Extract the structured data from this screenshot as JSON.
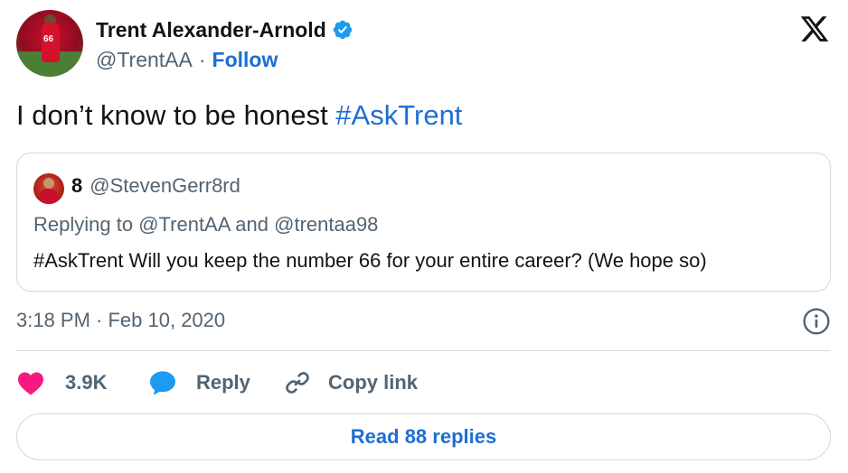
{
  "author": {
    "display_name": "Trent Alexander-Arnold",
    "handle": "@TrentAA",
    "follow_label": "Follow",
    "separator": "·"
  },
  "tweet": {
    "text": "I don’t know to be honest ",
    "hashtag": "#AskTrent"
  },
  "quoted": {
    "display_name": "8",
    "handle": "@StevenGerr8rd",
    "reply_prefix": "Replying to ",
    "mention_1": "@TrentAA",
    "reply_joiner": " and ",
    "mention_2": "@trentaa98",
    "text": "#AskTrent Will you keep the number 66 for your entire career? (We hope so)"
  },
  "meta": {
    "timestamp": "3:18 PM · Feb 10, 2020"
  },
  "actions": {
    "like_count": "3.9K",
    "reply_label": "Reply",
    "copy_label": "Copy link",
    "read_replies_label": "Read 88 replies"
  },
  "colors": {
    "accent": "#1d6fd1",
    "like": "#f91880",
    "reply_icon": "#1d9bf0",
    "muted": "#536471",
    "border": "#cfd9de"
  },
  "icons": {
    "verified": "verified-badge-icon",
    "brand": "x-logo-icon",
    "info": "info-icon",
    "like": "heart-icon",
    "reply": "speech-bubble-icon",
    "copy": "link-icon"
  }
}
